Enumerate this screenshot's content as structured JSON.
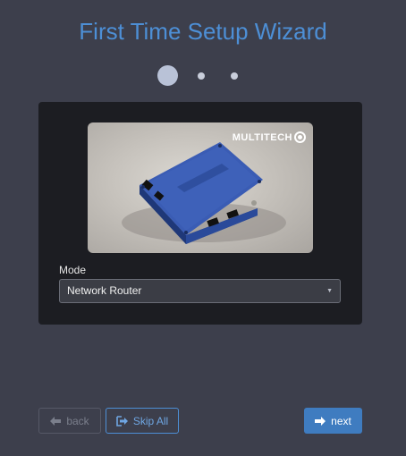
{
  "wizard": {
    "title": "First Time Setup Wizard",
    "steps_total": 3,
    "current_step": 1
  },
  "image": {
    "logo_text": "MULTITECH",
    "logo_icon": "circle-logo-icon"
  },
  "mode": {
    "label": "Mode",
    "selected": "Network Router"
  },
  "footer": {
    "back_label": "back",
    "skip_label": "Skip All",
    "next_label": "next"
  },
  "colors": {
    "background": "#3d3f4c",
    "panel": "#1c1d22",
    "accent": "#4d8fd6",
    "primary_button": "#3f7cc0"
  }
}
